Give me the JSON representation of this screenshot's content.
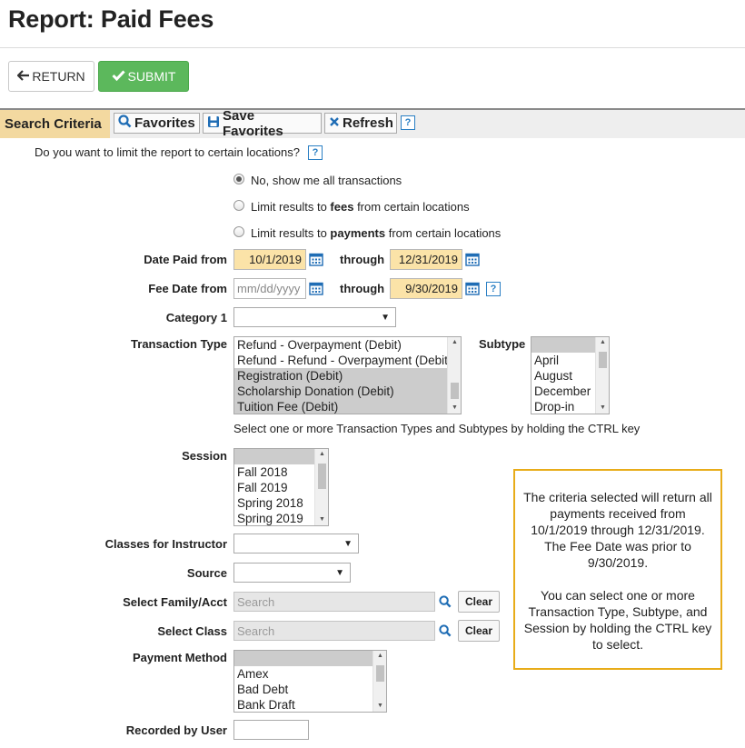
{
  "page": {
    "title": "Report: Paid Fees"
  },
  "actions": {
    "return_label": "RETURN",
    "submit_label": "SUBMIT"
  },
  "toolbar": {
    "section_label": "Search Criteria",
    "favorites_label": "Favorites",
    "save_favorites_label": "Save Favorites",
    "refresh_label": "Refresh",
    "help_glyph": "?"
  },
  "locations": {
    "question": "Do you want to limit the report to certain locations?",
    "options": [
      {
        "label": "No, show me all transactions",
        "selected": true
      },
      {
        "prefix": "Limit results to ",
        "bold": "fees",
        "suffix": " from certain locations",
        "selected": false
      },
      {
        "prefix": "Limit results to ",
        "bold": "payments",
        "suffix": " from certain locations",
        "selected": false
      }
    ]
  },
  "dates": {
    "date_paid_label": "Date Paid from",
    "date_paid_from": "10/1/2019",
    "through_label": "through",
    "date_paid_to": "12/31/2019",
    "fee_date_label": "Fee Date from",
    "fee_date_from_placeholder": "mm/dd/yyyy",
    "fee_date_to": "9/30/2019"
  },
  "category1": {
    "label": "Category 1",
    "value": ""
  },
  "transaction_type": {
    "label": "Transaction Type",
    "options": [
      {
        "label": "Refund - Overpayment (Debit)",
        "selected": false
      },
      {
        "label": "Refund - Refund - Overpayment (Debit)",
        "selected": false
      },
      {
        "label": "Registration (Debit)",
        "selected": true
      },
      {
        "label": "Scholarship Donation (Debit)",
        "selected": true
      },
      {
        "label": "Tuition Fee (Debit)",
        "selected": true
      }
    ]
  },
  "subtype": {
    "label": "Subtype",
    "options": [
      {
        "label": "",
        "selected": true
      },
      {
        "label": "April",
        "selected": false
      },
      {
        "label": "August",
        "selected": false
      },
      {
        "label": "December",
        "selected": false
      },
      {
        "label": "Drop-in",
        "selected": false
      }
    ]
  },
  "hint": "Select one or more Transaction Types and Subtypes by holding the CTRL key",
  "session": {
    "label": "Session",
    "options": [
      {
        "label": "",
        "selected": true
      },
      {
        "label": "Fall 2018",
        "selected": false
      },
      {
        "label": "Fall 2019",
        "selected": false
      },
      {
        "label": "Spring 2018",
        "selected": false
      },
      {
        "label": "Spring 2019",
        "selected": false
      }
    ]
  },
  "classes_for_instructor": {
    "label": "Classes for Instructor",
    "value": ""
  },
  "source": {
    "label": "Source",
    "value": ""
  },
  "select_family": {
    "label": "Select Family/Acct",
    "placeholder": "Search",
    "clear_label": "Clear"
  },
  "select_class": {
    "label": "Select Class",
    "placeholder": "Search",
    "clear_label": "Clear"
  },
  "payment_method": {
    "label": "Payment Method",
    "options": [
      {
        "label": "",
        "selected": true
      },
      {
        "label": "Amex",
        "selected": false
      },
      {
        "label": "Bad Debt",
        "selected": false
      },
      {
        "label": "Bank Draft",
        "selected": false
      }
    ]
  },
  "recorded_by_user": {
    "label": "Recorded by User",
    "value": ""
  },
  "note": {
    "paragraph1": "The criteria selected will return all payments received from 10/1/2019 through 12/31/2019. The Fee Date was prior to 9/30/2019.",
    "paragraph2": "You can select one or more Transaction Type, Subtype, and Session by holding the CTRL key to select."
  },
  "colors": {
    "accent_green": "#5cb85c",
    "date_highlight": "#fbe3a8",
    "search_criteria_tab": "#f3d9a0",
    "note_border": "#e8ac19",
    "help_blue": "#2a7fc4"
  },
  "icons": [
    "arrow-left-icon",
    "check-icon",
    "search-icon",
    "save-icon",
    "close-icon",
    "help-icon",
    "calendar-icon",
    "dropdown-arrow-icon"
  ]
}
